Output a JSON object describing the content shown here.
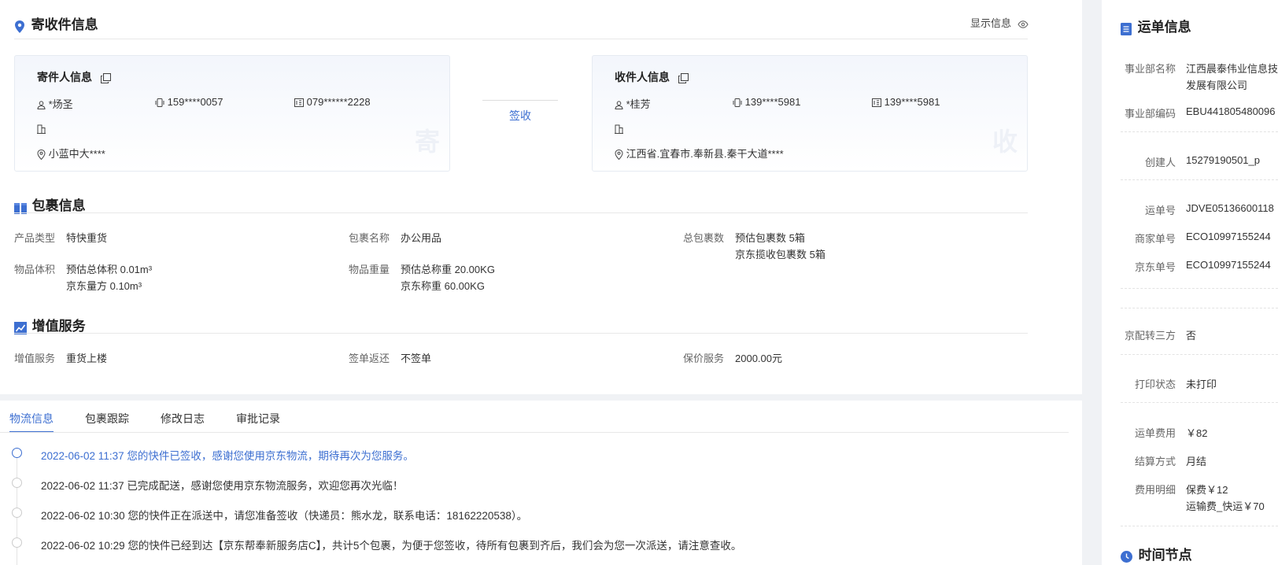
{
  "sender_receiver": {
    "title": "寄收件信息",
    "show_info_label": "显示信息",
    "sign_label": "签收",
    "sender": {
      "title": "寄件人信息",
      "name": "*炀圣",
      "mobile": "159****0057",
      "phone": "079******2228",
      "address": "小蓝中大****",
      "watermark": "寄"
    },
    "receiver": {
      "title": "收件人信息",
      "name": "*桂芳",
      "mobile": "139****5981",
      "phone": "139****5981",
      "address": "江西省.宜春市.奉新县.秦干大道****",
      "watermark": "收"
    }
  },
  "package": {
    "title": "包裹信息",
    "fields": [
      {
        "label": "产品类型",
        "lines": [
          "特快重货"
        ]
      },
      {
        "label": "包裹名称",
        "lines": [
          "办公用品"
        ]
      },
      {
        "label": "总包裹数",
        "lines": [
          "预估包裹数 5箱",
          "京东揽收包裹数 5箱"
        ]
      },
      {
        "label": "物品体积",
        "lines": [
          "预估总体积 0.01m³",
          "京东量方 0.10m³"
        ]
      },
      {
        "label": "物品重量",
        "lines": [
          "预估总称重 20.00KG",
          "京东称重 60.00KG"
        ]
      }
    ]
  },
  "value_added": {
    "title": "增值服务",
    "fields": [
      {
        "label": "增值服务",
        "value": "重货上楼"
      },
      {
        "label": "签单返还",
        "value": "不签单"
      },
      {
        "label": "保价服务",
        "value": "2000.00元"
      }
    ]
  },
  "tabs": [
    "物流信息",
    "包裹跟踪",
    "修改日志",
    "审批记录"
  ],
  "timeline": [
    "2022-06-02 11:37 您的快件已签收，感谢您使用京东物流，期待再次为您服务。",
    "2022-06-02 11:37 已完成配送，感谢您使用京东物流服务，欢迎您再次光临！",
    "2022-06-02 10:30 您的快件正在派送中，请您准备签收（快递员：熊水龙，联系电话：18162220538）。",
    "2022-06-02 10:29 您的快件已经到达【京东帮奉新服务店C】，共计5个包裹，为便于您签收，待所有包裹到齐后，我们会为您一次派送，请注意查收。"
  ],
  "waybill": {
    "title": "运单信息",
    "rows": [
      {
        "label": "事业部名称",
        "lines": [
          "江西晨泰伟业信息技",
          "发展有限公司"
        ]
      },
      {
        "label": "事业部编码",
        "lines": [
          "EBU441805480096"
        ]
      },
      {
        "label": "创建人",
        "lines": [
          "15279190501_p"
        ]
      },
      {
        "label": "运单号",
        "lines": [
          "JDVE05136600118"
        ]
      },
      {
        "label": "商家单号",
        "lines": [
          "ECO10997155244"
        ]
      },
      {
        "label": "京东单号",
        "lines": [
          "ECO10997155244"
        ]
      },
      {
        "label": "京配转三方",
        "lines": [
          "否"
        ]
      },
      {
        "label": "打印状态",
        "lines": [
          "未打印"
        ]
      },
      {
        "label": "运单费用",
        "lines": [
          "￥82"
        ]
      },
      {
        "label": "结算方式",
        "lines": [
          "月结"
        ]
      },
      {
        "label": "费用明细",
        "lines": [
          "保费￥12",
          "运输费_快运￥70"
        ]
      }
    ],
    "time_nodes_title": "时间节点"
  },
  "colors": {
    "accent": "#3d6fd1",
    "icon_blue": "#3d6fd1"
  }
}
